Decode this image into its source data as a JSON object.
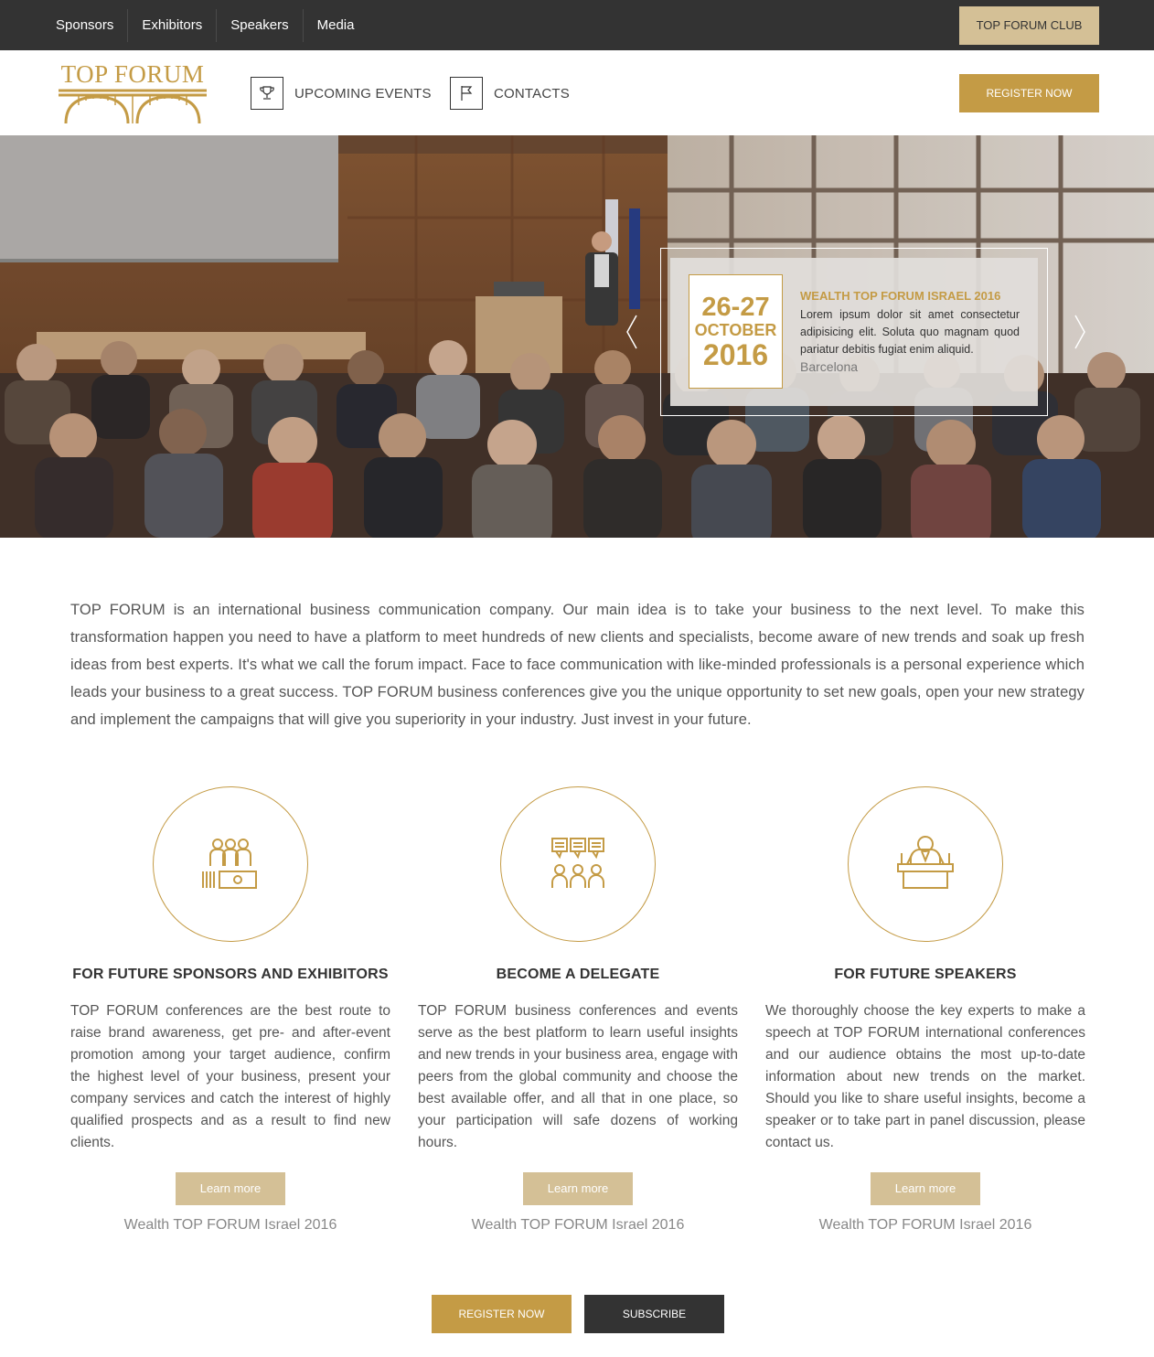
{
  "topnav": {
    "items": [
      {
        "label": "Sponsors"
      },
      {
        "label": "Exhibitors"
      },
      {
        "label": "Speakers"
      },
      {
        "label": "Media"
      }
    ],
    "club_button": "TOP FORUM CLUB"
  },
  "header": {
    "logo_text": "TOP FORUM",
    "logo_icon": "bridge-icon",
    "nav": [
      {
        "label": "UPCOMING EVENTS",
        "icon": "trophy-icon"
      },
      {
        "label": "CONTACTS",
        "icon": "flag-icon"
      }
    ],
    "register_label": "REGISTER NOW"
  },
  "hero": {
    "date_days": "26-27",
    "date_month": "OCTOBER",
    "date_year": "2016",
    "event_title": "WEALTH TOP FORUM ISRAEL 2016",
    "event_desc": "Lorem ipsum dolor sit amet consectetur adipisicing elit. Soluta quo magnam quod pariatur debitis fugiat enim aliquid.",
    "event_city": "Barcelona"
  },
  "intro": "TOP FORUM is an international business communication company. Our main idea is to take your business to the next level. To make this transformation happen you need to have a platform to meet hundreds of new clients and specialists, become aware of new trends and soak up fresh ideas from best experts. It's what we call the forum impact. Face to face communication with like-minded professionals is a personal experience which leads your business to a great success. TOP FORUM business conferences give you the unique opportunity to set new goals, open your new strategy and implement the campaigns that will give you superiority in your industry. Just invest in your future.",
  "features": [
    {
      "icon": "sponsors-icon",
      "title": "FOR FUTURE SPONSORS AND EXHIBITORS",
      "text": "TOP FORUM conferences are the best route to raise brand awareness, get pre- and after-event promotion among your target audience, confirm the highest level of your business, present your company services and catch the interest of highly qualified prospects and as a result to find new clients.",
      "button": "Learn more",
      "link": "Wealth TOP FORUM Israel 2016"
    },
    {
      "icon": "delegates-icon",
      "title": "BECOME A DELEGATE",
      "text": "TOP FORUM business conferences and events serve as the best platform to learn useful insights and new trends in your business area, engage with peers from the global community and choose the best available offer, and all that in one place, so your participation will safe dozens of working hours.",
      "button": "Learn more",
      "link": "Wealth TOP FORUM Israel 2016"
    },
    {
      "icon": "speaker-icon",
      "title": "FOR FUTURE SPEAKERS",
      "text": "We thoroughly choose the key experts to make a speech at TOP FORUM international conferences and our audience obtains the most up-to-date information about new trends on the market. Should you like to share useful insights, become a speaker or to take part in panel discussion, please contact us.",
      "button": "Learn more",
      "link": "Wealth TOP FORUM Israel 2016"
    }
  ],
  "bottom": {
    "register_label": "REGISTER NOW",
    "subscribe_label": "SUBSCRIBE"
  },
  "colors": {
    "accent": "#c49b45",
    "accent_light": "#d4c096",
    "dark": "#333333"
  }
}
